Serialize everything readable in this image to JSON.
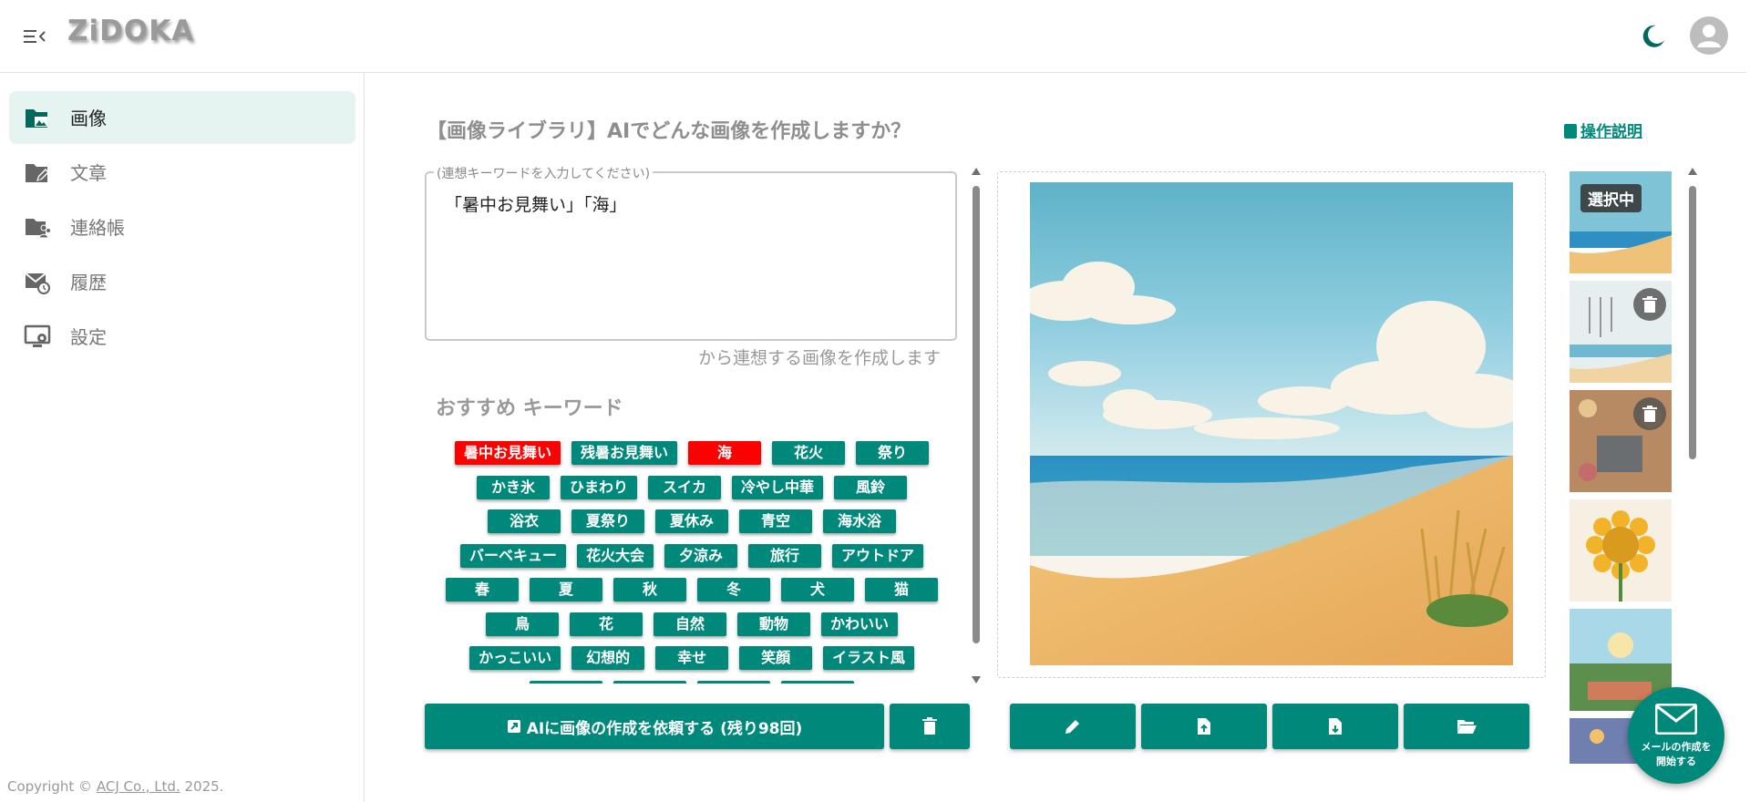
{
  "app": {
    "logo": "ZiDOKA"
  },
  "header": {
    "menu_icon": "menu-collapse-icon",
    "theme_icon": "moon-icon",
    "account_icon": "account-icon"
  },
  "sidebar": {
    "items": [
      {
        "label": "画像",
        "icon": "image-folder-icon",
        "active": true
      },
      {
        "label": "文章",
        "icon": "edit-folder-icon",
        "active": false
      },
      {
        "label": "連絡帳",
        "icon": "contacts-folder-icon",
        "active": false
      },
      {
        "label": "履歴",
        "icon": "mail-history-icon",
        "active": false
      },
      {
        "label": "設定",
        "icon": "settings-monitor-icon",
        "active": false
      }
    ],
    "copyright_prefix": "Copyright © ",
    "copyright_company": "ACJ Co., Ltd.",
    "copyright_year": " 2025."
  },
  "main": {
    "title": "【画像ライブラリ】AIでどんな画像を作成しますか？",
    "help_link": "操作説明",
    "keyword_field": {
      "legend": "(連想キーワードを入力してください)",
      "value": "「暑中お見舞い」「海」",
      "suffix": "から連想する画像を作成します"
    },
    "recommend_title": "おすすめ キーワード",
    "keyword_rows": [
      [
        "暑中お見舞い",
        "残暑お見舞い",
        "海",
        "花火",
        "祭り"
      ],
      [
        "かき氷",
        "ひまわり",
        "スイカ",
        "冷やし中華",
        "風鈴"
      ],
      [
        "浴衣",
        "夏祭り",
        "夏休み",
        "青空",
        "海水浴"
      ],
      [
        "バーベキュー",
        "花火大会",
        "夕涼み",
        "旅行",
        "アウトドア"
      ],
      [
        "春",
        "夏",
        "秋",
        "冬",
        "犬",
        "猫"
      ],
      [
        "鳥",
        "花",
        "自然",
        "動物",
        "かわいい"
      ],
      [
        "かっこいい",
        "幻想的",
        "幸せ",
        "笑顔",
        "イラスト風"
      ],
      [
        "",
        "",
        "",
        ""
      ]
    ],
    "selected_keywords": [
      "暑中お見舞い",
      "海"
    ],
    "generate_button": "AIに画像の作成を依頼する (残り98回)",
    "thumbnail_badge": "選択中",
    "fab_label_line1": "メールの作成を",
    "fab_label_line2": "開始する"
  },
  "colors": {
    "accent": "#00897b",
    "selected_chip": "#ff0000",
    "active_nav_bg": "#e6f4f1"
  }
}
